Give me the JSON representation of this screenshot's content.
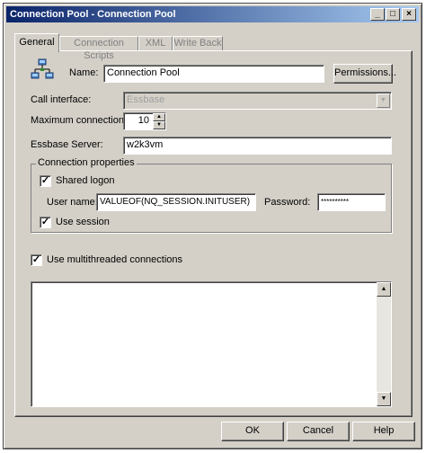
{
  "window": {
    "title": "Connection Pool - Connection Pool",
    "controls": {
      "minimize": "_",
      "maximize": "□",
      "close": "×"
    }
  },
  "tabs": [
    {
      "label": "General",
      "active": true
    },
    {
      "label": "Connection Scripts",
      "active": false
    },
    {
      "label": "XML",
      "active": false
    },
    {
      "label": "Write Back",
      "active": false
    }
  ],
  "general": {
    "icon": "network-icon",
    "name_label": "Name:",
    "name_value": "Connection Pool",
    "permissions_label": "Permissions...",
    "call_interface_label": "Call interface:",
    "call_interface_value": "Essbase",
    "max_connections_label": "Maximum connections:",
    "max_connections_value": "10",
    "server_label": "Essbase Server:",
    "server_value": "w2k3vm",
    "connection_properties": {
      "title": "Connection properties",
      "shared_logon_label": "Shared logon",
      "shared_logon_checked": true,
      "user_name_label": "User name:",
      "user_name_value": "VALUEOF(NQ_SESSION.INITUSER)",
      "password_label": "Password:",
      "password_value": "**********",
      "use_session_label": "Use session",
      "use_session_checked": true
    },
    "multithreaded_label": "Use multithreaded connections",
    "multithreaded_checked": true,
    "description_value": ""
  },
  "footer": {
    "ok_label": "OK",
    "cancel_label": "Cancel",
    "help_label": "Help"
  },
  "glyphs": {
    "check": "✓",
    "dropdown": "▼",
    "spin_up": "▲",
    "spin_down": "▼",
    "scroll_up": "▲",
    "scroll_down": "▼"
  }
}
